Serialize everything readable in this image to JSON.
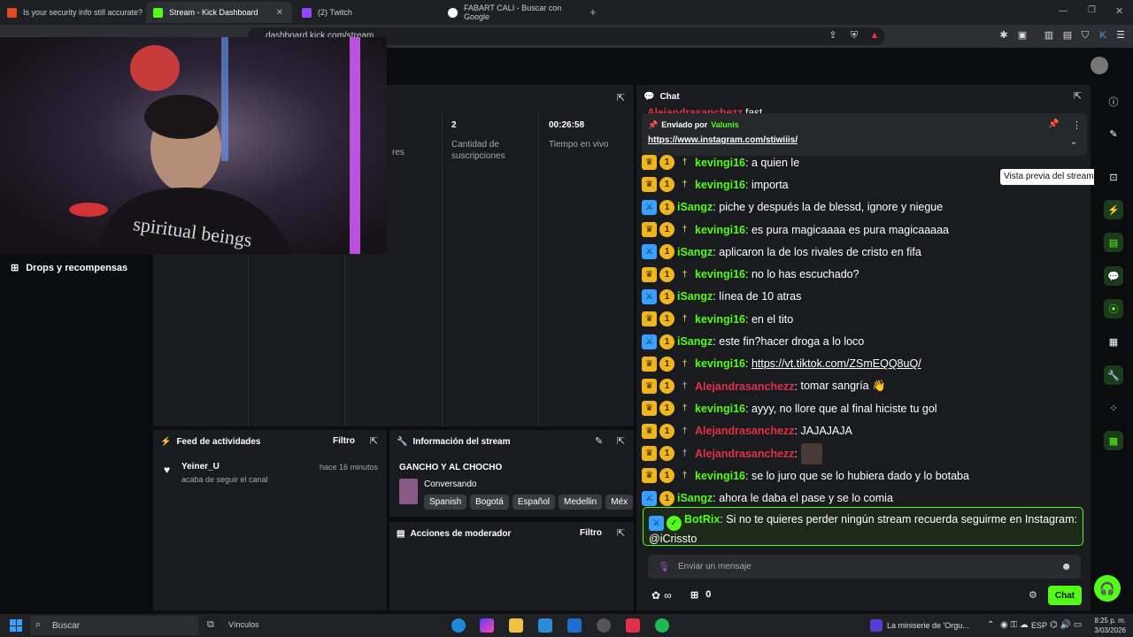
{
  "browser": {
    "tabs": [
      {
        "title": "Is your security info still accurate?",
        "color": "#e34a1f"
      },
      {
        "title": "Stream - Kick Dashboard",
        "color": "#53fc18"
      },
      {
        "title": "(2) Twitch",
        "color": "#9146ff"
      },
      {
        "title": "FABART CALI - Buscar con Google",
        "color": "#ffffff"
      }
    ],
    "url": "dashboard.kick.com/stream"
  },
  "stats": [
    {
      "value": "",
      "label": "res"
    },
    {
      "value": "2",
      "label": "Cantidad de suscripciones"
    },
    {
      "value": "00:26:58",
      "label": "Tiempo en vivo"
    }
  ],
  "sidebar": {
    "drops_label": "Drops y recompensas"
  },
  "activity": {
    "title": "Feed de actividades",
    "filter": "Filtro",
    "item": {
      "user": "Yeiner_U",
      "action": "acaba de seguir el canal",
      "time": "hace 16 minutos"
    }
  },
  "stream_info": {
    "title": "Información del stream",
    "stream_title": "GANCHO Y AL CHOCHO",
    "category": "Conversando",
    "tags": [
      "Spanish",
      "Bogotá",
      "Español",
      "Medellin",
      "Méx"
    ]
  },
  "moderator": {
    "title": "Acciones de moderador",
    "filter": "Filtro"
  },
  "chat": {
    "title": "Chat",
    "pinned_by_label": "Enviado por",
    "pinned_by_user": "Valunis",
    "pinned_link": "https://www.instagram.com/stiwiiis/",
    "top_partial_user": "Alejandrasanchezz",
    "top_partial_text": "fast",
    "messages": [
      {
        "user": "kevingi16",
        "text": "a quien le",
        "type": "kevin"
      },
      {
        "user": "kevingi16",
        "text": "importa",
        "type": "kevin"
      },
      {
        "user": "iSangz",
        "text": "piche y después la de blessd, ignore y niegue",
        "type": "isangz"
      },
      {
        "user": "kevingi16",
        "text": "es pura magicaaaa es pura magicaaaaa",
        "type": "kevin"
      },
      {
        "user": "iSangz",
        "text": "aplicaron la de los rivales de cristo en fifa",
        "type": "isangz"
      },
      {
        "user": "kevingi16",
        "text": "no lo has escuchado?",
        "type": "kevin"
      },
      {
        "user": "iSangz",
        "text": "línea de 10 atras",
        "type": "isangz"
      },
      {
        "user": "kevingi16",
        "text": "en el tito",
        "type": "kevin"
      },
      {
        "user": "iSangz",
        "text": "este fin?hacer droga a lo loco",
        "type": "isangz"
      },
      {
        "user": "kevingi16",
        "text": "https://vt.tiktok.com/ZSmEQQ8uQ/",
        "type": "kevin"
      },
      {
        "user": "Alejandrasanchezz",
        "text": "tomar sangría 👋",
        "type": "ale"
      },
      {
        "user": "kevingi16",
        "text": "ayyy, no llore que al final hiciste tu gol",
        "type": "kevin"
      },
      {
        "user": "Alejandrasanchezz",
        "text": "JAJAJAJA",
        "type": "ale"
      },
      {
        "user": "Alejandrasanchezz",
        "text": "",
        "type": "ale"
      },
      {
        "user": "kevingi16",
        "text": "se lo juro que se lo hubiera dado y lo botaba",
        "type": "kevin"
      },
      {
        "user": "iSangz",
        "text": "ahora le daba el pase y se lo comia",
        "type": "isangz"
      }
    ],
    "bot": {
      "user": "BotRix",
      "text": "Si no te quieres perder ningún stream recuerda seguirme en Instagram: @iCrissto"
    },
    "input_placeholder": "Enviar un mensaje",
    "viewer_count": "0",
    "chat_button": "Chat",
    "colors": {
      "kevin": "#53fc18",
      "isangz": "#53fc18",
      "ale": "#e0304a",
      "bot": "#53fc18"
    }
  },
  "tooltip": "Vista previa del stream",
  "taskbar": {
    "search": "Buscar",
    "links": "Vínculos",
    "media": "La miniserie de 'Orgu...",
    "lang": "ESP",
    "time": "8:25 p. m.",
    "date": "3/03/2026"
  }
}
